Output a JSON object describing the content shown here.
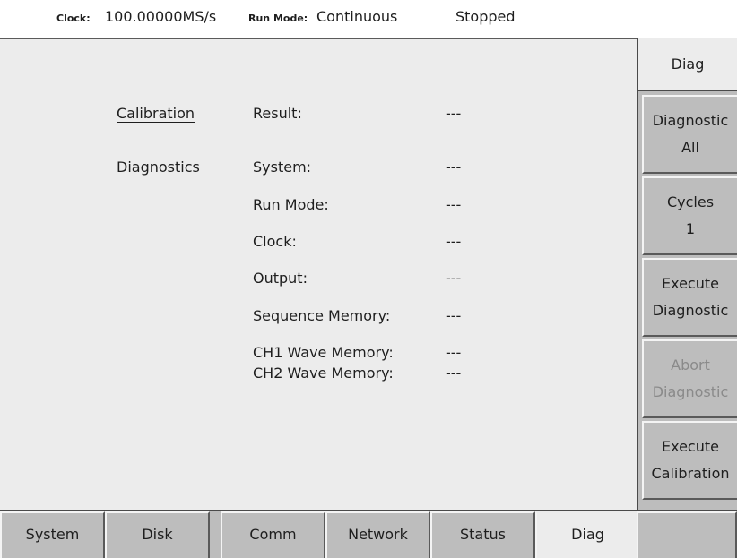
{
  "status_bar": {
    "clock_label": "Clock:",
    "clock_value": "100.00000MS/s",
    "run_mode_label": "Run Mode:",
    "run_mode_value": "Continuous",
    "state": "Stopped"
  },
  "main": {
    "calibration": {
      "section_label": "Calibration",
      "rows": [
        {
          "label": "Result:",
          "value": "---"
        }
      ]
    },
    "diagnostics": {
      "section_label": "Diagnostics",
      "rows": [
        {
          "label": "System:",
          "value": "---"
        },
        {
          "label": "Run Mode:",
          "value": "---"
        },
        {
          "label": "Clock:",
          "value": "---"
        },
        {
          "label": "Output:",
          "value": "---"
        },
        {
          "label": "Sequence Memory:",
          "value": "---"
        },
        {
          "label": "CH1 Wave Memory:",
          "value": "---"
        },
        {
          "label": "CH2 Wave Memory:",
          "value": "---"
        }
      ]
    }
  },
  "right_menu": {
    "title": "Diag",
    "buttons": [
      {
        "line1": "Diagnostic",
        "line2": "All",
        "enabled": true
      },
      {
        "line1": "Cycles",
        "line2": "1",
        "enabled": true
      },
      {
        "line1": "Execute",
        "line2": "Diagnostic",
        "enabled": true
      },
      {
        "line1": "Abort",
        "line2": "Diagnostic",
        "enabled": false
      },
      {
        "line1": "Execute",
        "line2": "Calibration",
        "enabled": true
      }
    ]
  },
  "bottom_tabs": [
    {
      "label": "System"
    },
    {
      "label": "Disk"
    },
    {
      "label": "Comm"
    },
    {
      "label": "Network"
    },
    {
      "label": "Status"
    },
    {
      "label": "Diag",
      "active": true
    },
    {
      "label": ""
    }
  ],
  "colors": {
    "panel_bg": "#ececec",
    "button_face": "#bdbdbd",
    "text": "#1e1e1e",
    "disabled_text": "#8a8a8a"
  }
}
